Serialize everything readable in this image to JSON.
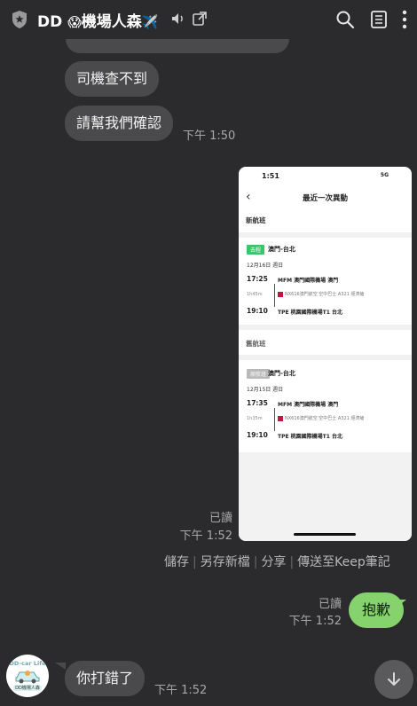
{
  "header": {
    "title": "DD",
    "title_emoji": "😱",
    "title_suffix": "機場人森",
    "title_plane": "✈️",
    "icons": [
      "shield-icon",
      "mute-icon",
      "external-link-icon",
      "search-icon",
      "note-icon",
      "more-icon"
    ]
  },
  "messages": {
    "m1": "司機查不到",
    "m2": "請幫我們確認",
    "m2_time": "下午 1:50",
    "image_read": "已讀",
    "image_time": "下午 1:52",
    "my_read": "已讀",
    "my_time": "下午 1:52",
    "my_text": "抱歉",
    "last_text": "你打錯了",
    "last_time": "下午 1:52"
  },
  "actions": {
    "save": "儲存",
    "save_as": "另存新檔",
    "share": "分享",
    "keep": "傳送至Keep筆記"
  },
  "screenshot": {
    "status_time": "1:51",
    "status_signal": "5G",
    "nav_title": "最近一次異動",
    "new_section": "新航班",
    "old_section": "舊航班",
    "new_badge": "去程",
    "old_badge": "原航班",
    "route": "澳門-台北",
    "new_date": "12月16日 週日",
    "old_date": "12月15日 週日",
    "new_dep_time": "17:25",
    "new_dep_airport": "MFM 澳門國際機場 澳門",
    "new_duration": "1h45m",
    "new_airline": "NX616澳門航空 空中巴士 A321 經濟艙",
    "new_arr_time": "19:10",
    "new_arr_airport": "TPE 桃園國際機場T1 台北",
    "old_dep_time": "17:35",
    "old_dep_airport": "MFM 澳門國際機場 澳門",
    "old_duration": "1h35m",
    "old_airline": "NX616澳門航空 空中巴士 A321 經濟艙",
    "old_arr_time": "19:10",
    "old_arr_airport": "TPE 桃園國際機場T1 台北"
  },
  "avatar": {
    "top_text": "DD-car Life",
    "bottom_text": "DD機場人森"
  },
  "colors": {
    "background": "#2b2b2d",
    "bubble": "#4a4a4c",
    "my_bubble": "#86d36e",
    "badge_green": "#3cc46a"
  }
}
